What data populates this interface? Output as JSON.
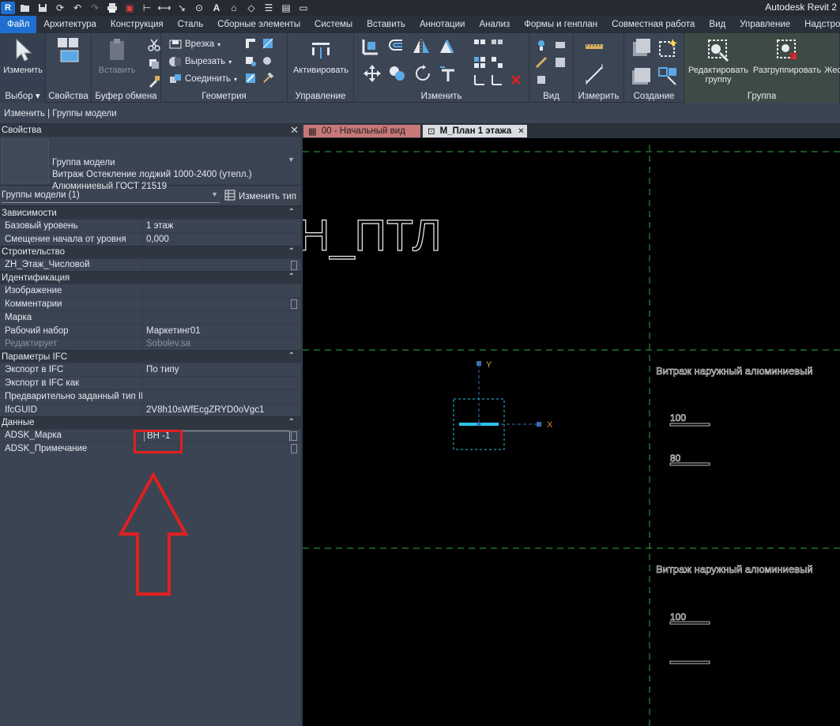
{
  "app_title": "Autodesk Revit 2",
  "quick_access_icons": [
    "open-icon",
    "save-icon",
    "sync-icon",
    "undo-icon",
    "redo-icon",
    "print-icon",
    "measure-icon",
    "dimension-icon",
    "text-icon",
    "home-icon",
    "close-hidden-icon",
    "switch-windows-icon"
  ],
  "tabs": [
    "Файл",
    "Архитектура",
    "Конструкция",
    "Сталь",
    "Сборные элементы",
    "Системы",
    "Вставить",
    "Аннотации",
    "Анализ",
    "Формы и генплан",
    "Совместная работа",
    "Вид",
    "Управление",
    "Надстройки"
  ],
  "ribbon": {
    "select": {
      "modify_label": "Изменить",
      "panel_label": "Выбор ▾"
    },
    "properties": {
      "label": "Свойства"
    },
    "clipboard": {
      "paste_label": "Вставить",
      "panel_label": "Буфер обмена"
    },
    "geometry": {
      "cut_label": "Врезка",
      "cut2_label": "Вырезать",
      "join_label": "Соединить",
      "panel_label": "Геометрия"
    },
    "control": {
      "activate_label": "Активировать",
      "panel_label": "Управление"
    },
    "modify": {
      "panel_label": "Изменить"
    },
    "view": {
      "panel_label": "Вид"
    },
    "measure": {
      "panel_label": "Измерить"
    },
    "create": {
      "panel_label": "Создание"
    },
    "group": {
      "edit_label_1": "Редактировать",
      "edit_label_2": "группу",
      "ungroup_label": "Разгруппировать",
      "extra_label": "Жес",
      "panel_label": "Группа"
    }
  },
  "context_bar": "Изменить | Группы модели",
  "properties": {
    "title": "Свойства",
    "type_lines": [
      "Группа модели",
      "Витраж Остекление лоджий 1000-2400 (утепл.)",
      "Алюминиевый ГОСТ 21519"
    ],
    "filter": "Группы модели (1)",
    "edit_type": "Изменить тип",
    "groups": [
      {
        "name": "Зависимости",
        "rows": [
          {
            "name": "Базовый уровень",
            "value": "1 этаж"
          },
          {
            "name": "Смещение начала от уровня",
            "value": "0,000"
          }
        ]
      },
      {
        "name": "Строительство",
        "rows": [
          {
            "name": "ZH_Этаж_Числовой",
            "value": "",
            "check": true
          }
        ]
      },
      {
        "name": "Идентификация",
        "rows": [
          {
            "name": "Изображение",
            "value": ""
          },
          {
            "name": "Комментарии",
            "value": "",
            "check": true
          },
          {
            "name": "Марка",
            "value": ""
          },
          {
            "name": "Рабочий набор",
            "value": "Маркетинг01"
          },
          {
            "name": "Редактирует",
            "value": "Sobolev.sa",
            "dim": true
          }
        ]
      },
      {
        "name": "Параметры IFC",
        "rows": [
          {
            "name": "Экспорт в IFC",
            "value": "По типу"
          },
          {
            "name": "Экспорт в IFC как",
            "value": ""
          },
          {
            "name": "Предварительно заданный тип IFC",
            "value": ""
          },
          {
            "name": "IfcGUID",
            "value": "2V8h10sWfEcgZRYD0oVgc1"
          }
        ]
      },
      {
        "name": "Данные",
        "rows": [
          {
            "name": "ADSK_Марка",
            "value": "ВН -1",
            "input": true,
            "check": true
          },
          {
            "name": "ADSK_Примечание",
            "value": "",
            "check": true
          }
        ]
      }
    ]
  },
  "view_tabs": [
    {
      "label": "00 - Начальный вид",
      "active": false
    },
    {
      "label": "М_План 1 этажа",
      "active": true
    }
  ],
  "canvas": {
    "big_text": "Н_ПТЛ",
    "label_1": "Витраж наружный алюминиевый",
    "label_2": "Витраж наружный алюминиевый",
    "dim_1": "100",
    "dim_2": "80",
    "dim_3": "100",
    "axis_x": "X",
    "axis_y": "Y"
  },
  "colors": {
    "accent": "#1e6fd0",
    "annotation_red": "#e02020",
    "grid_green": "#2fa84a",
    "element_cyan": "#29c4e6",
    "axis_x_orange": "#e08a2a",
    "axis_y_orange": "#d6a64a"
  }
}
